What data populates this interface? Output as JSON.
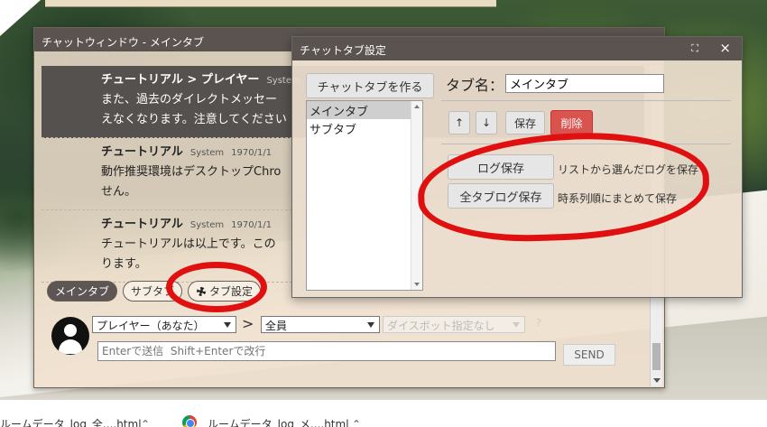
{
  "chat_window": {
    "title": "チャットウィンドウ - メインタブ",
    "messages": [
      {
        "name": "チュートリアル > プレイヤー",
        "source": "System",
        "date": "",
        "text": "また、過去のダイレクトメッセー",
        "text2": "えなくなります。注意してください"
      },
      {
        "name": "チュートリアル",
        "source": "System",
        "date": "1970/1/1",
        "text": "動作推奨環境はデスクトップChro",
        "text2": "せん。"
      },
      {
        "name": "チュートリアル",
        "source": "System",
        "date": "1970/1/1",
        "text": "チュートリアルは以上です。この",
        "text2": "ります。"
      }
    ],
    "tabs": [
      {
        "label": "メインタブ"
      },
      {
        "label": "サブタブ"
      },
      {
        "label": "タブ設定"
      }
    ],
    "sender_select": "プレイヤー（あなた）",
    "separator": ">",
    "target_select": "全員",
    "dice_select": "ダイスボット指定なし",
    "help_label": "?",
    "input_placeholder": "Enterで送信  Shift+Enterで改行",
    "send_label": "SEND"
  },
  "settings_dialog": {
    "title": "チャットタブ設定",
    "create_tab_label": "チャットタブを作る",
    "tab_list": [
      "メインタブ",
      "サブタブ"
    ],
    "tab_name_label": "タブ名：",
    "tab_name_value": "メインタブ",
    "move_up_label": "↑",
    "move_down_label": "↓",
    "save_label": "保存",
    "delete_label": "削除",
    "log_save_label": "ログ保存",
    "log_save_desc": "リストから選んだログを保存",
    "all_tab_log_label": "全タブログ保存",
    "all_tab_log_desc": "時系列順にまとめて保存"
  },
  "downloads": [
    {
      "name": "ルームデータ_log_全....html"
    },
    {
      "name": "ルームデータ_log_メ....html"
    }
  ],
  "colors": {
    "annotation": "#e01010",
    "titlebar": "#5a5350",
    "delete": "#d9534f"
  }
}
